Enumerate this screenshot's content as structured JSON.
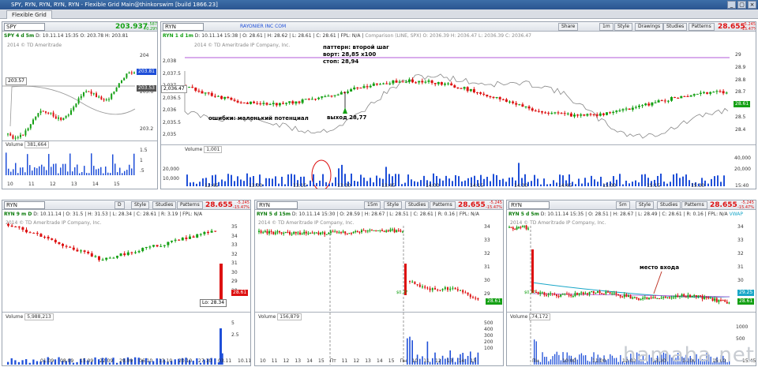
{
  "window": {
    "title": "SPY, RYN, RYN, RYN, RYN - Flexible Grid Main@thinkorswim [build 1866.23]",
    "tab": "Flexible Grid"
  },
  "colors": {
    "up": "#14a014",
    "down": "#dd1111",
    "accent_blue": "#1f4fd8",
    "purple_line": "#b05ad8",
    "comparison": "#888888"
  },
  "panels": {
    "spy": {
      "symbol": "SPY",
      "price": "203.937",
      "chg1": "+.587",
      "chg2": "+0.29%",
      "info": {
        "label": "SPY 4 d 5m",
        "d": "D: 10.11.14 15:35",
        "o": "O: 203.78",
        "h": "H: 203.81"
      },
      "watermark": "2014 © TD Ameritrade",
      "yaxis": [
        "204",
        "203.6",
        "203.2"
      ],
      "tags": {
        "last": "203.81",
        "avg": "203.53",
        "left": "203.57"
      },
      "volume_label": "Volume",
      "volume_value": "381,664",
      "vaxis": [
        "1.5",
        "1",
        ".5"
      ],
      "xaxis": [
        "10",
        "11",
        "12",
        "13",
        "14",
        "15"
      ]
    },
    "main": {
      "symbol": "RYN",
      "company": "RAYONIER INC COM",
      "buttons": [
        "Share",
        "1m",
        "Style",
        "Drawings",
        "Studies",
        "Patterns"
      ],
      "price": "28.655",
      "chg1": "-5.245",
      "chg2": "-15.47%",
      "info": {
        "label": "RYN 1 d 1m",
        "d": "D: 10.11.14 15:38",
        "o": "O: 28.61",
        "h": "H: 28.62",
        "l": "L: 28.61",
        "c": "C: 28.61",
        "fpl": "FPL: N/A",
        "cmp": "Comparison (LINE, SPX)",
        "o2": "O: 2036.39",
        "h2": "H: 2036.47",
        "l2": "L: 2036.39",
        "c2": "C: 2036.47"
      },
      "watermark": "2014 © TD Ameritrade IP Company, Inc.",
      "yaxis_left": [
        "2,038",
        "2,037.5",
        "2,037",
        "2,036.5",
        "2,036",
        "2,035.5",
        "2,035"
      ],
      "yaxis_right": [
        "29",
        "28.9",
        "28.8",
        "28.7",
        "28.6",
        "28.5",
        "28.4"
      ],
      "left_tag": "2,036.47",
      "right_tag": "28.61",
      "annotations": {
        "pattern1": "паттерн: второй шаг",
        "pattern2": "ворт: 28,85 x100",
        "pattern3": "стоп: 28,94",
        "errors": "ошибки: маленький потенциал",
        "exit": "выход 28,77"
      },
      "volume_label": "Volume",
      "volume_value": "1,001",
      "vaxis_left": [
        "20,000",
        "10,000"
      ],
      "vaxis_right": [
        "40,000",
        "20,000"
      ],
      "xaxis": [
        "12:45",
        "13:00",
        "13:15",
        "13:30",
        "13:45",
        "14:00",
        "14:15",
        "14:30",
        "14:45",
        "15:00",
        "15:15",
        "15:30",
        "15:40"
      ]
    },
    "b1": {
      "symbol": "RYN",
      "tf": "D",
      "buttons": [
        "Style",
        "Studies",
        "Patterns"
      ],
      "price": "28.655",
      "chg1": "-5.245",
      "chg2": "-15.47%",
      "info": {
        "label": "RYN 9 m D",
        "d": "D: 10.11.14",
        "o": "O: 31.5",
        "h": "H: 31.53",
        "l": "L: 28.34",
        "c": "C: 28.61",
        "r": "R: 3.19",
        "fpl": "FPL: N/A"
      },
      "watermark": "2014 © TD Ameritrade IP Company, Inc.",
      "yaxis": [
        "35",
        "34",
        "33",
        "32",
        "31",
        "30",
        "29",
        "28"
      ],
      "tag": "28.61",
      "low": "Lo: 28.34",
      "volume_label": "Volume",
      "volume_value": "5,988,213",
      "vaxis": [
        "5",
        "2.5"
      ],
      "xaxis": [
        "01.09",
        "08.09",
        "15.09",
        "22.09",
        "29.09",
        "06.10",
        "13.10",
        "20.10",
        "27.10",
        "03.11",
        "10.11"
      ]
    },
    "b2": {
      "symbol": "RYN",
      "tf": "15m",
      "buttons": [
        "Style",
        "Studies",
        "Patterns"
      ],
      "price": "28.655",
      "chg1": "-5.245",
      "chg2": "-15.47%",
      "info": {
        "label": "RYN 5 d 15m",
        "d": "D: 10.11.14 15:30",
        "o": "O: 28.59",
        "h": "H: 28.67",
        "l": "L: 28.51",
        "c": "C: 28.61",
        "r": "R: 0.16",
        "fpl": "FPL: N/A"
      },
      "watermark": "2014 © TD Ameritrade IP Company, Inc.",
      "yaxis": [
        "34",
        "33",
        "32",
        "31",
        "30",
        "29"
      ],
      "tag": "28.61",
      "small": "$0.27",
      "volume_label": "Volume",
      "volume_value": "156,879",
      "vaxis": [
        "500",
        "400",
        "300",
        "200",
        "100"
      ],
      "xaxis": [
        "10",
        "11",
        "12",
        "13",
        "14",
        "15",
        "Пт",
        "11",
        "12",
        "13",
        "14",
        "15",
        "Пн",
        "10",
        "11",
        "12",
        "13",
        "14",
        "15"
      ]
    },
    "b3": {
      "symbol": "RYN",
      "tf": "5m",
      "buttons": [
        "Style",
        "Studies",
        "Patterns"
      ],
      "price": "28.655",
      "chg1": "-5.245",
      "chg2": "-15.47%",
      "info": {
        "label": "RYN 5 d 5m",
        "d": "D: 10.11.14 15:35",
        "o": "O: 28.51",
        "h": "H: 28.67",
        "l": "L: 28.49",
        "c": "C: 28.61",
        "r": "R: 0.16",
        "fpl": "FPL: N/A",
        "study": "VWAP"
      },
      "watermark": "2014 © TD Ameritrade IP Company, Inc.",
      "yaxis": [
        "34",
        "33",
        "32",
        "31",
        "30",
        "29"
      ],
      "tags": {
        "a": "29.25",
        "b": "28.61"
      },
      "small": "$0.27",
      "annotation": "место входа",
      "volume_label": "Volume",
      "volume_value": "74,172",
      "vaxis": [
        "1000",
        "500"
      ],
      "xaxis": [
        "Пн",
        "10:00",
        "11:00",
        "12:00",
        "13:00",
        "14:00",
        "15:00",
        "15:45"
      ]
    }
  },
  "site_watermark": "hamaha.net"
}
